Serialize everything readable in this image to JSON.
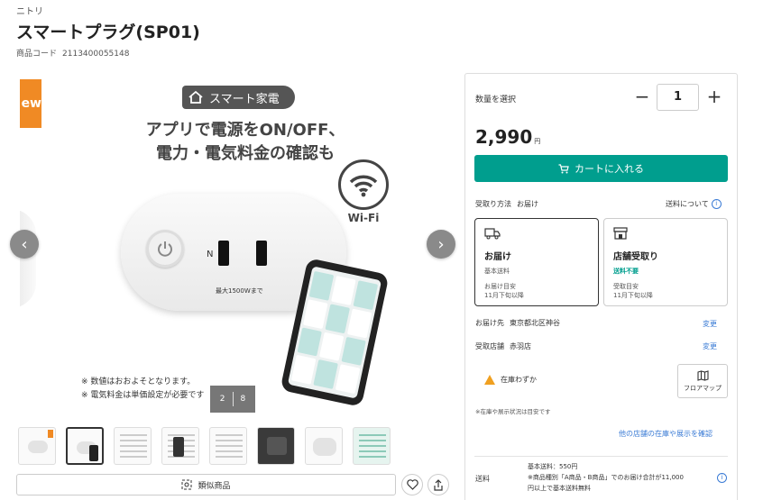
{
  "product": {
    "brand": "ニトリ",
    "title": "スマートプラグ(SP01)",
    "code_label": "商品コード",
    "code_value": "2113400055148"
  },
  "hero": {
    "badge": "スマート家電",
    "headline_line1": "アプリで電源をON/OFF、",
    "headline_line2": "電力・電気料金の確認も",
    "wifi_label": "Wi-Fi",
    "n_label": "N",
    "max_label": "最大1500Wまで",
    "note1": "※ 数値はおおよそとなります。",
    "note2": "※ 電気料金は単価設定が必要です",
    "counter_current": "2",
    "counter_total": "8",
    "tag_text": "ew"
  },
  "buttons": {
    "prev": "‹",
    "next": "›",
    "similar": "類似商品"
  },
  "purchase": {
    "qty_label": "数量を選択",
    "qty_value": "1",
    "minus": "−",
    "plus": "+",
    "price": "2,990",
    "price_unit": "円",
    "cart": "カートに入れる",
    "method_label": "受取り方法",
    "method_value": "お届け",
    "fee_link": "送料について"
  },
  "options": {
    "delivery": {
      "title": "お届け",
      "sub": "基本送料",
      "eta_label": "お届け目安",
      "eta_value": "11月下旬以降"
    },
    "store": {
      "title": "店舗受取り",
      "sub": "送料不要",
      "eta_label": "受取目安",
      "eta_value": "11月下旬以降"
    }
  },
  "details": {
    "address_label": "お届け先",
    "address_value": "東京都北区神谷",
    "store_label": "受取店舗",
    "store_value": "赤羽店",
    "change": "変更",
    "stock": "在庫わずか",
    "floor_map": "フロアマップ",
    "stock_note": "※在庫や展示状況は目安です",
    "other_stores": "他の店舗の在庫や展示を確認",
    "ship_label": "送料",
    "ship_line1": "基本送料：550円",
    "ship_line2": "※商品種別「A商品・B商品」でのお届け合計が11,000",
    "ship_line3": "円以上で基本送料無料"
  },
  "colors": {
    "accent": "#009e8e",
    "link": "#3a7bd5",
    "tag": "#f08a24"
  }
}
